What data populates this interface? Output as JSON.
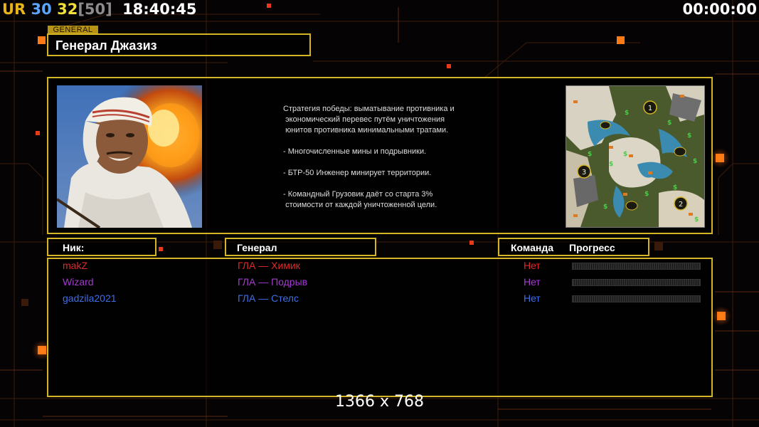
{
  "hud": {
    "prefix": "UR",
    "value_a": "30",
    "value_b": "32",
    "value_c": "[50]",
    "clock": "18:40:45",
    "timer": "00:00:00"
  },
  "general": {
    "tab_label": "GENERAL",
    "name": "Генерал Джазиз",
    "description": "Стратегия победы: выматывание противника и\n экономический перевес путём уничтожения\n юнитов противника минимальными тратами.\n\n- Многочисленные мины и подрывники.\n\n- БТР-50 Инженер минирует территории.\n\n- Командный Грузовик даёт со старта 3%\n стоимости от каждой уничтоженной цели.",
    "portrait_icon": "commander-portrait-image",
    "map_icon": "minimap-image",
    "map_start_labels": [
      "1",
      "2",
      "3"
    ]
  },
  "table": {
    "col_nick": "Ник:",
    "col_general": "Генерал",
    "col_team": "Команда",
    "col_progress": "Прогресс",
    "players": [
      {
        "nick": "makZ",
        "general": "ГЛА — Химик",
        "team": "Нет",
        "color": "#e02828",
        "progress": 0
      },
      {
        "nick": "Wizard",
        "general": "ГЛА — Подрыв",
        "team": "Нет",
        "color": "#a43ad0",
        "progress": 0
      },
      {
        "nick": "gadzila2021",
        "general": "ГЛА — Стелс",
        "team": "Нет",
        "color": "#3f6ee8",
        "progress": 0
      }
    ]
  },
  "resolution": "1366 x 768",
  "colors": {
    "frame": "#d4b526",
    "accent": "#ff7a14"
  }
}
